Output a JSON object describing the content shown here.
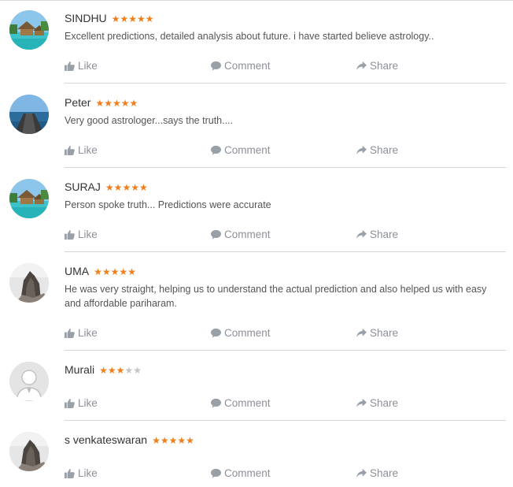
{
  "actions": {
    "like": "Like",
    "comment": "Comment",
    "share": "Share"
  },
  "star_glyph": "★",
  "colors": {
    "star_filled": "#f07f1b",
    "star_empty": "#c4c4c4",
    "action_text": "#8d9099"
  },
  "reviews": [
    {
      "name": "SINDHU",
      "rating": 5,
      "avatar": "beach-huts",
      "text": "Excellent predictions, detailed analysis about future. i have started believe astrology.."
    },
    {
      "name": "Peter",
      "rating": 5,
      "avatar": "pier",
      "text": "Very good astrologer...says the truth...."
    },
    {
      "name": "SURAJ",
      "rating": 5,
      "avatar": "beach-huts",
      "text": "Person spoke truth... Predictions were accurate"
    },
    {
      "name": "UMA",
      "rating": 5,
      "avatar": "rock",
      "text": "He was very straight, helping us to understand the actual prediction and also helped us with easy and affordable pariharam."
    },
    {
      "name": "Murali",
      "rating": 3,
      "avatar": "default-person",
      "text": ""
    },
    {
      "name": "s venkateswaran",
      "rating": 5,
      "avatar": "rock",
      "text": ""
    }
  ]
}
